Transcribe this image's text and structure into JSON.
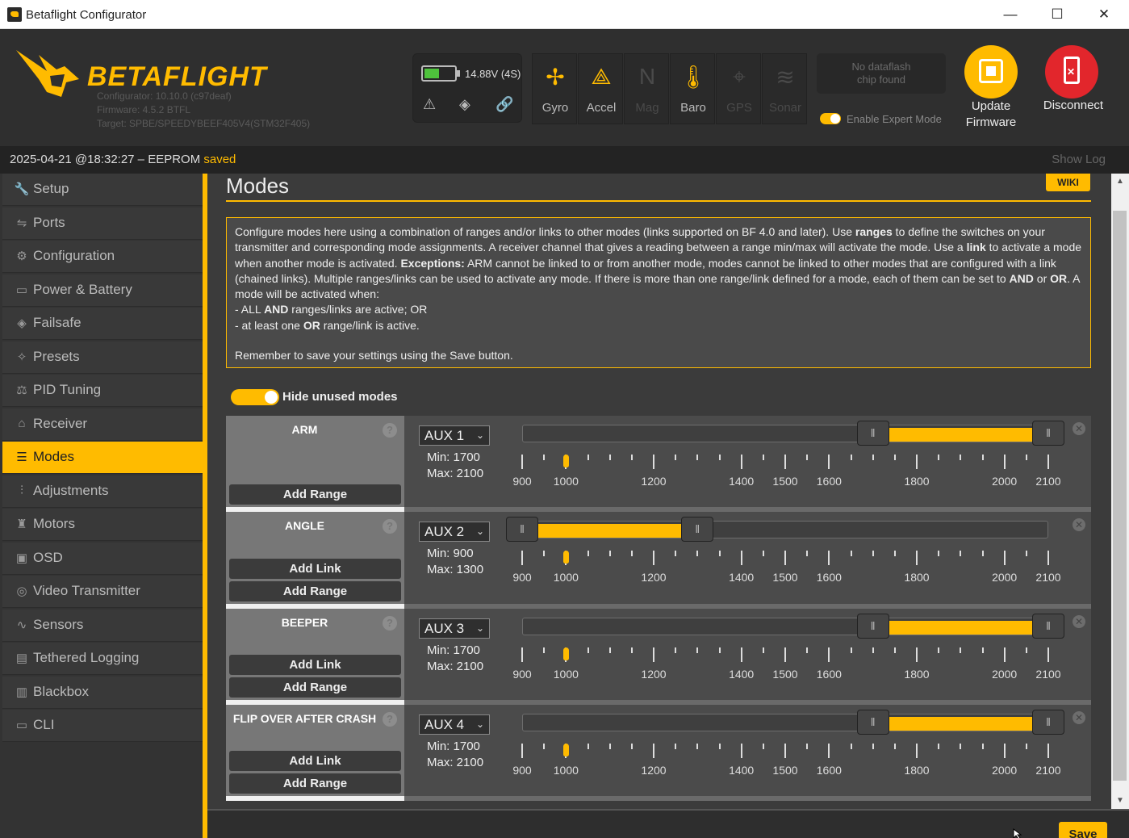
{
  "window": {
    "title": "Betaflight Configurator",
    "minimize_glyph": "—",
    "maximize_glyph": "☐",
    "close_glyph": "✕"
  },
  "header": {
    "brand": "BETAFLIGHT",
    "configurator_version": "Configurator: 10.10.0 (c97deaf)",
    "firmware": "Firmware: 4.5.2 BTFL",
    "target": "Target: SPBE/SPEEDYBEEF405V4(STM32F405)",
    "voltage": "14.88V (4S)",
    "battery_level_fraction": 0.5,
    "battery_icons": [
      "warning-icon",
      "failsafe-icon",
      "link-icon"
    ],
    "sensors": [
      {
        "label": "Gyro",
        "icon": "gyro-icon",
        "active": true
      },
      {
        "label": "Accel",
        "icon": "accel-icon",
        "active": true
      },
      {
        "label": "Mag",
        "icon": "mag-icon",
        "active": false
      },
      {
        "label": "Baro",
        "icon": "baro-icon",
        "active": true
      },
      {
        "label": "GPS",
        "icon": "gps-icon",
        "active": false
      },
      {
        "label": "Sonar",
        "icon": "sonar-icon",
        "active": false
      }
    ],
    "dataflash_line1": "No dataflash",
    "dataflash_line2": "chip found",
    "expert_mode_label": "Enable Expert Mode",
    "expert_mode_on": true,
    "update_firmware_line1": "Update",
    "update_firmware_line2": "Firmware",
    "disconnect_label": "Disconnect"
  },
  "status": {
    "prefix": "2025-04-21 @18:32:27 – EEPROM",
    "state": "saved",
    "show_log": "Show Log"
  },
  "sidebar": {
    "items": [
      {
        "label": "Setup",
        "icon": "wrench-icon",
        "glyph": "🔧"
      },
      {
        "label": "Ports",
        "icon": "ports-icon",
        "glyph": "⇋"
      },
      {
        "label": "Configuration",
        "icon": "gear-icon",
        "glyph": "⚙"
      },
      {
        "label": "Power & Battery",
        "icon": "battery-icon",
        "glyph": "▭"
      },
      {
        "label": "Failsafe",
        "icon": "failsafe-icon",
        "glyph": "◈"
      },
      {
        "label": "Presets",
        "icon": "presets-icon",
        "glyph": "✧"
      },
      {
        "label": "PID Tuning",
        "icon": "pid-icon",
        "glyph": "⚖"
      },
      {
        "label": "Receiver",
        "icon": "receiver-icon",
        "glyph": "⌂"
      },
      {
        "label": "Modes",
        "icon": "modes-icon",
        "glyph": "☰",
        "active": true
      },
      {
        "label": "Adjustments",
        "icon": "adjustments-icon",
        "glyph": "⫶"
      },
      {
        "label": "Motors",
        "icon": "motors-icon",
        "glyph": "♜"
      },
      {
        "label": "OSD",
        "icon": "osd-icon",
        "glyph": "▣"
      },
      {
        "label": "Video Transmitter",
        "icon": "vtx-icon",
        "glyph": "◎"
      },
      {
        "label": "Sensors",
        "icon": "sensors-icon",
        "glyph": "∿"
      },
      {
        "label": "Tethered Logging",
        "icon": "tethered-logging-icon",
        "glyph": "▤"
      },
      {
        "label": "Blackbox",
        "icon": "blackbox-icon",
        "glyph": "▥"
      },
      {
        "label": "CLI",
        "icon": "cli-icon",
        "glyph": "▭"
      }
    ]
  },
  "main": {
    "title": "Modes",
    "wiki": "WIKI",
    "note": {
      "p1_a": "Configure modes here using a combination of ranges and/or links to other modes (links supported on BF 4.0 and later). Use ",
      "p1_b": "ranges",
      "p1_c": " to define the switches on your transmitter and corresponding mode assignments. A receiver channel that gives a reading between a range min/max will activate the mode. Use a ",
      "p1_d": "link",
      "p1_e": " to activate a mode when another mode is activated. ",
      "p1_f": "Exceptions:",
      "p1_g": " ARM cannot be linked to or from another mode, modes cannot be linked to other modes that are configured with a link (chained links). Multiple ranges/links can be used to activate any mode. If there is more than one range/link defined for a mode, each of them can be set to ",
      "p1_h": "AND",
      "p1_i": " or ",
      "p1_j": "OR",
      "p1_k": ". A mode will be activated when:",
      "l1_a": "- ALL ",
      "l1_b": "AND",
      "l1_c": " ranges/links are active; OR",
      "l2_a": "- at least one ",
      "l2_b": "OR",
      "l2_c": " range/link is active.",
      "p2": "Remember to save your settings using the Save button."
    },
    "hide_unused_label": "Hide unused modes",
    "hide_unused_on": true,
    "add_link_label": "Add Link",
    "add_range_label": "Add Range",
    "help_glyph": "?",
    "remove_glyph": "✕",
    "tick_labels": [
      "900",
      "1000",
      "1200",
      "1400",
      "1500",
      "1600",
      "1800",
      "2000",
      "2100"
    ],
    "modes": [
      {
        "name": "ARM",
        "has_link": false,
        "channel": "AUX 1",
        "min_label": "Min: 1700",
        "max_label": "Max: 2100",
        "min": 1700,
        "max": 2100,
        "channel_value": 1000
      },
      {
        "name": "ANGLE",
        "has_link": true,
        "channel": "AUX 2",
        "min_label": "Min: 900",
        "max_label": "Max: 1300",
        "min": 900,
        "max": 1300,
        "channel_value": 1000
      },
      {
        "name": "BEEPER",
        "has_link": true,
        "channel": "AUX 3",
        "min_label": "Min: 1700",
        "max_label": "Max: 2100",
        "min": 1700,
        "max": 2100,
        "channel_value": 1000
      },
      {
        "name": "FLIP OVER AFTER CRASH",
        "has_link": true,
        "channel": "AUX 4",
        "min_label": "Min: 1700",
        "max_label": "Max: 2100",
        "min": 1700,
        "max": 2100,
        "channel_value": 1000
      }
    ]
  },
  "footer": {
    "save_label": "Save"
  }
}
